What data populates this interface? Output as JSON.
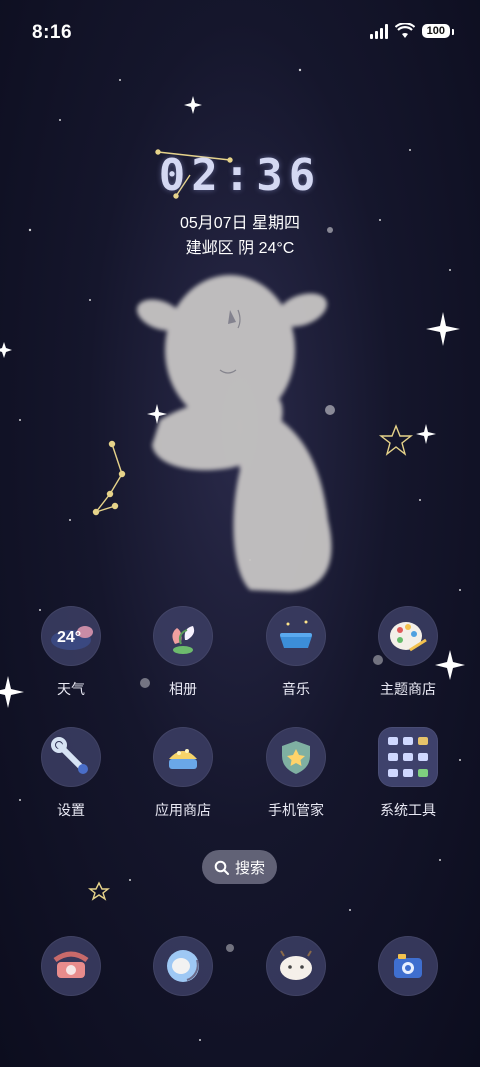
{
  "status_bar": {
    "time": "8:16",
    "battery": "100"
  },
  "lockclock": {
    "time": "02:36",
    "date": "05月07日 星期四",
    "weather": "建邺区 阴 24°C"
  },
  "apps": [
    {
      "label": "天气",
      "icon": "weather-icon",
      "badge": "24°"
    },
    {
      "label": "相册",
      "icon": "gallery-icon"
    },
    {
      "label": "音乐",
      "icon": "music-icon"
    },
    {
      "label": "主题商店",
      "icon": "theme-store-icon"
    },
    {
      "label": "设置",
      "icon": "settings-icon"
    },
    {
      "label": "应用商店",
      "icon": "app-store-icon"
    },
    {
      "label": "手机管家",
      "icon": "phone-manager-icon"
    },
    {
      "label": "系统工具",
      "icon": "system-tools-folder-icon"
    }
  ],
  "search": {
    "label": "搜索"
  },
  "dock": [
    {
      "icon": "phone-icon"
    },
    {
      "icon": "browser-icon"
    },
    {
      "icon": "messages-icon"
    },
    {
      "icon": "camera-icon"
    }
  ]
}
